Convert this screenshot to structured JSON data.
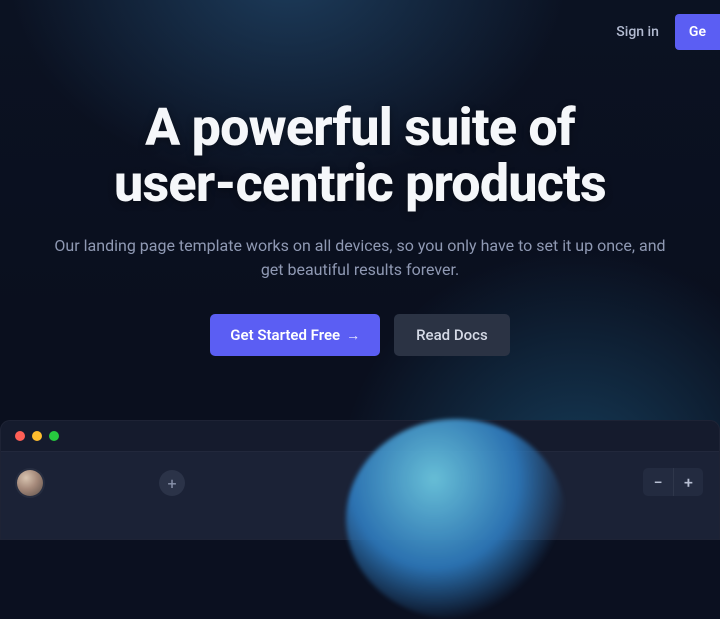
{
  "nav": {
    "signin": "Sign in",
    "get_started": "Ge"
  },
  "hero": {
    "title_line1": "A powerful suite of",
    "title_line2": "user-centric products",
    "subtitle": "Our landing page template works on all devices, so you only have to set it up once, and get beautiful results forever."
  },
  "cta": {
    "primary": "Get Started Free",
    "primary_arrow": "→",
    "secondary": "Read Docs"
  },
  "mock": {
    "add": "+",
    "zoom_minus": "−",
    "zoom_plus": "+"
  },
  "colors": {
    "accent": "#5b5ef3",
    "bg": "#0b1020"
  }
}
